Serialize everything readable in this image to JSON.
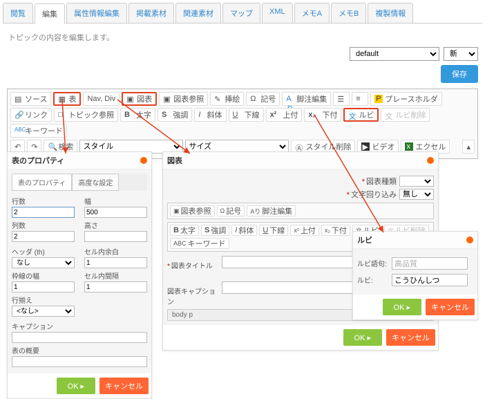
{
  "tabs": [
    "閲覧",
    "編集",
    "属性情報編集",
    "掲載素材",
    "関連素材",
    "マップ",
    "XML",
    "メモA",
    "メモB",
    "複製情報"
  ],
  "activeTab": 1,
  "hint": "トピックの内容を編集します。",
  "selects": {
    "mode": "default",
    "new": "新規"
  },
  "save": "保存",
  "toolbar": {
    "r1": {
      "source": "ソース",
      "table": "表",
      "navdiv": "Nav, Div",
      "figure": "図表",
      "figref": "図表参照",
      "insert": "挿絵",
      "symbol": "記号",
      "footnote": "脚注編集",
      "list": "",
      "placeholder": "プレースホルダ"
    },
    "r2": {
      "link": "リンク",
      "topicref": "トピック参照",
      "bold": "太字",
      "strong": "強調",
      "italic": "斜体",
      "underline": "下線",
      "sup": "上付",
      "sub": "下付",
      "ruby": "ルビ",
      "rubydel": "ルビ削除",
      "keyword": "キーワード"
    },
    "r3": {
      "undo": "",
      "redo": "",
      "search": "検索",
      "style": "スタイル",
      "size": "サイズ",
      "styledel": "スタイル削除",
      "video": "ビデオ",
      "excel": "エクセル"
    }
  },
  "tableProps": {
    "title": "表のプロパティ",
    "subtabs": [
      "表のプロパティ",
      "高度な設定"
    ],
    "rows": "行数",
    "rowsv": "2",
    "width": "幅",
    "widthv": "500",
    "cols": "列数",
    "colsv": "2",
    "height": "高さ",
    "heightv": "",
    "header": "ヘッダ (th)",
    "headerv": "なし",
    "cellpad": "セル内余白",
    "cellpadv": "1",
    "border": "枠線の幅",
    "borderv": "1",
    "cellspace": "セル内間隔",
    "cellspacev": "1",
    "align": "行揃え",
    "alignv": "<なし>",
    "caption": "キャプション",
    "captionv": "",
    "summary": "表の概要",
    "summaryv": "",
    "ok": "OK",
    "cancel": "キャンセル"
  },
  "figure": {
    "title": "図表",
    "figtype": "図表種類",
    "wrap": "文字回り込み",
    "wrapv": "無し",
    "mtb": {
      "figref": "図表参照",
      "sym": "記号",
      "foot": "脚注編集",
      "bold": "太字",
      "strong": "強調",
      "italic": "斜体",
      "ul": "下線",
      "sup": "上付",
      "sub": "下付",
      "ruby": "ルビ",
      "rubydel": "ルビ削除",
      "kw": "キーワード"
    },
    "figtitle": "図表タイトル",
    "figcap": "図表キャプション",
    "bodyp": "body p",
    "ok": "OK",
    "cancel": "キャンセル"
  },
  "ruby": {
    "title": "ルビ",
    "word": "ルビ語句:",
    "wordv": "高品質",
    "rb": "ルビ:",
    "rbv": "こうひんしつ",
    "ok": "OK",
    "cancel": "キャンセル"
  }
}
